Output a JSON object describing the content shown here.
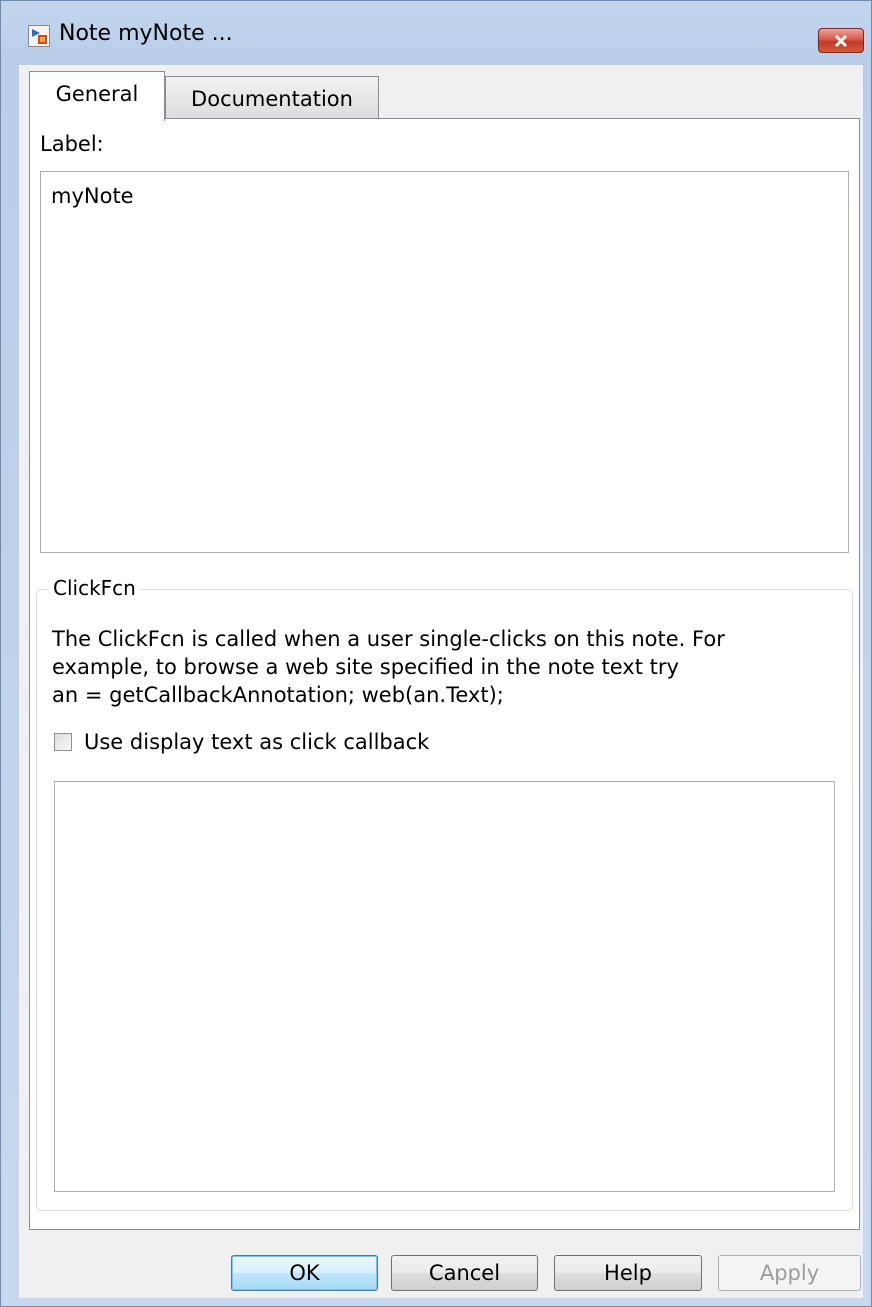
{
  "window": {
    "title": "Note myNote ...",
    "close_icon": "close-icon"
  },
  "tabs": [
    {
      "label": "General",
      "selected": true
    },
    {
      "label": "Documentation",
      "selected": false
    }
  ],
  "general": {
    "label_heading": "Label:",
    "label_value": "myNote",
    "clickfcn": {
      "legend": "ClickFcn",
      "description_lines": [
        "The ClickFcn is called when a user single-clicks on this note. For",
        "example, to browse a web site specified in the note text try",
        "an = getCallbackAnnotation; web(an.Text);"
      ],
      "checkbox_label": "Use display text as click callback",
      "checkbox_checked": false,
      "callback_value": ""
    }
  },
  "buttons": {
    "ok": "OK",
    "cancel": "Cancel",
    "help": "Help",
    "apply": "Apply"
  },
  "colors": {
    "title_bar": "#c4d6ee",
    "close_button": "#c94a3a",
    "ok_button_focus": "#3c7fb1"
  }
}
